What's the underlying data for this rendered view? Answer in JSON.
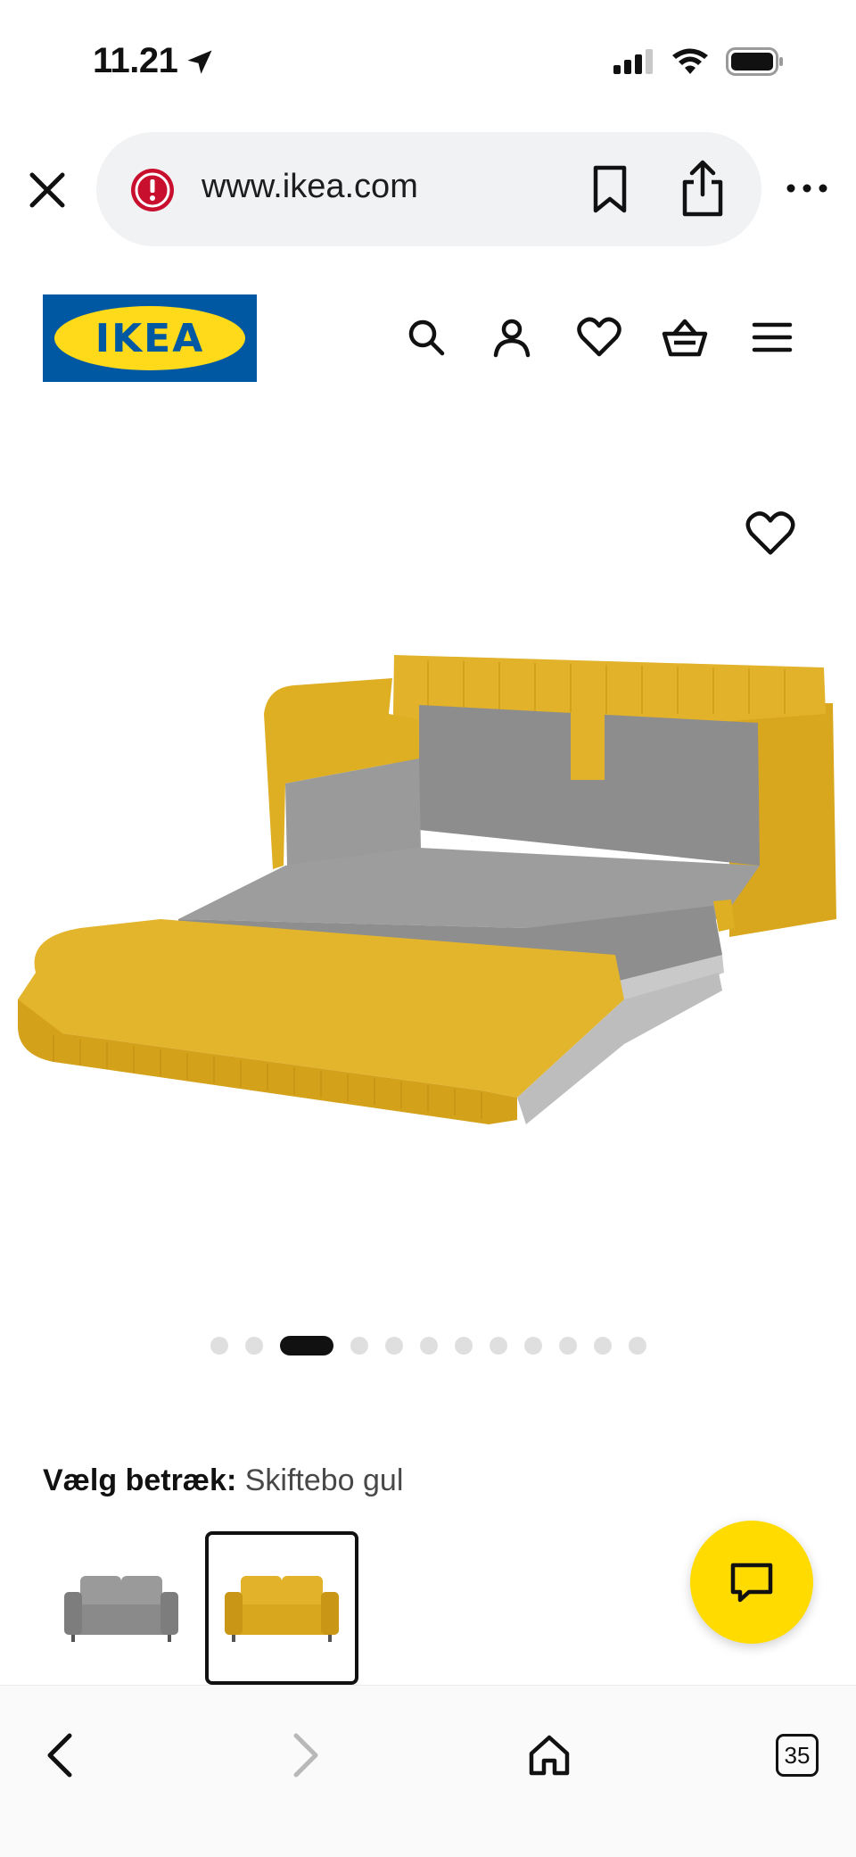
{
  "status_bar": {
    "time": "11.21",
    "icons": [
      "location-arrow-icon",
      "cellular-signal-icon",
      "wifi-icon",
      "battery-icon"
    ]
  },
  "browser": {
    "url": "www.ikea.com",
    "icons": [
      "close-icon",
      "warning-icon",
      "bookmark-icon",
      "share-icon",
      "more-icon"
    ]
  },
  "site_header": {
    "logo_text": "IKEA",
    "colors": {
      "logo_blue": "#0058a3",
      "logo_yellow": "#ffda1a"
    },
    "icons": [
      "search-icon",
      "account-icon",
      "heart-icon",
      "basket-icon",
      "menu-icon"
    ]
  },
  "product": {
    "image_alt": "Yellow sofa bed unfolded",
    "favorite_icon": "heart-icon",
    "carousel": {
      "total": 12,
      "active_index": 2
    }
  },
  "cover_selection": {
    "label": "Vælg betræk:",
    "value": "Skiftebo gul",
    "options": [
      {
        "name": "grey",
        "color": "#8a8a8a",
        "selected": false
      },
      {
        "name": "yellow",
        "color": "#e1b027",
        "selected": true
      }
    ]
  },
  "chat": {
    "icon": "chat-icon",
    "color": "#ffdb00"
  },
  "bottom_bar": {
    "tabs_count": "35",
    "icons": [
      "back-icon",
      "forward-icon",
      "home-icon",
      "tabs-icon"
    ]
  }
}
